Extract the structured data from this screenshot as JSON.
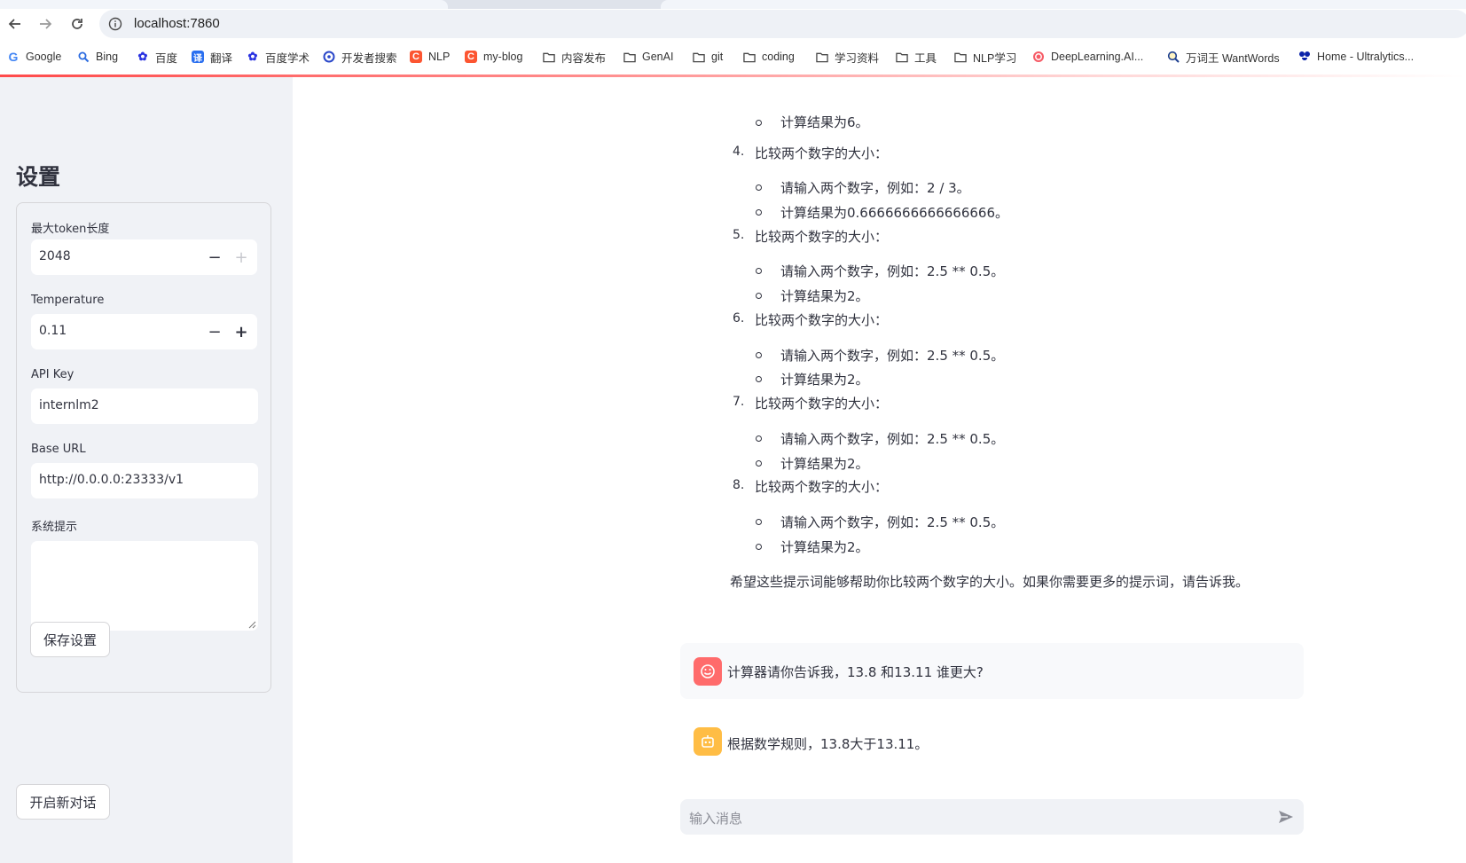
{
  "browser": {
    "url": "localhost:7860",
    "bookmarks": [
      {
        "label": "Google",
        "icon": "google-icon"
      },
      {
        "label": "Bing",
        "icon": "bing-icon"
      },
      {
        "label": "百度",
        "icon": "baidu-icon"
      },
      {
        "label": "翻译",
        "icon": "translate-icon"
      },
      {
        "label": "百度学术",
        "icon": "baidu-icon"
      },
      {
        "label": "开发者搜索",
        "icon": "dev-search-icon"
      },
      {
        "label": "NLP",
        "icon": "csdn-icon"
      },
      {
        "label": "my-blog",
        "icon": "csdn-icon"
      },
      {
        "label": "内容发布",
        "icon": "folder-icon"
      },
      {
        "label": "GenAI",
        "icon": "folder-icon"
      },
      {
        "label": "git",
        "icon": "folder-icon"
      },
      {
        "label": "coding",
        "icon": "folder-icon"
      },
      {
        "label": "学习资料",
        "icon": "folder-icon"
      },
      {
        "label": "工具",
        "icon": "folder-icon"
      },
      {
        "label": "NLP学习",
        "icon": "folder-icon"
      },
      {
        "label": "DeepLearning.AI...",
        "icon": "deeplearning-icon"
      },
      {
        "label": "万词王 WantWords",
        "icon": "wantwords-icon"
      },
      {
        "label": "Home - Ultralytics...",
        "icon": "ultralytics-icon"
      }
    ]
  },
  "sidebar": {
    "title": "设置",
    "max_tokens": {
      "label": "最大token长度",
      "value": "2048"
    },
    "temperature": {
      "label": "Temperature",
      "value": "0.11"
    },
    "api_key": {
      "label": "API Key",
      "value": "internlm2"
    },
    "base_url": {
      "label": "Base URL",
      "value": "http://0.0.0.0:23333/v1"
    },
    "system_prompt": {
      "label": "系统提示",
      "value": ""
    },
    "save_label": "保存设置",
    "new_chat_label": "开启新对话"
  },
  "chat": {
    "cut_text": "计算结果为6。",
    "items": [
      {
        "num": "4.",
        "title": "比较两个数字的大小：",
        "sub": [
          "请输入两个数字，例如：2 / 3。",
          "计算结果为0.6666666666666666。"
        ]
      },
      {
        "num": "5.",
        "title": "比较两个数字的大小：",
        "sub": [
          "请输入两个数字，例如：2.5 ** 0.5。",
          "计算结果为2。"
        ]
      },
      {
        "num": "6.",
        "title": "比较两个数字的大小：",
        "sub": [
          "请输入两个数字，例如：2.5 ** 0.5。",
          "计算结果为2。"
        ]
      },
      {
        "num": "7.",
        "title": "比较两个数字的大小：",
        "sub": [
          "请输入两个数字，例如：2.5 ** 0.5。",
          "计算结果为2。"
        ]
      },
      {
        "num": "8.",
        "title": "比较两个数字的大小：",
        "sub": [
          "请输入两个数字，例如：2.5 ** 0.5。",
          "计算结果为2。"
        ]
      }
    ],
    "closing": "希望这些提示词能够帮助你比较两个数字的大小。如果你需要更多的提示词，请告诉我。",
    "user_message": "计算器请你告诉我，13.8 和13.11 谁更大?",
    "bot_message": "根据数学规则，13.8大于13.11。",
    "input_placeholder": "输入消息"
  },
  "colors": {
    "accent": "#ff4b4b",
    "user_avatar": "#ff6b6b",
    "bot_avatar": "#ffbd45",
    "sidebar_bg": "#f0f2f6"
  }
}
